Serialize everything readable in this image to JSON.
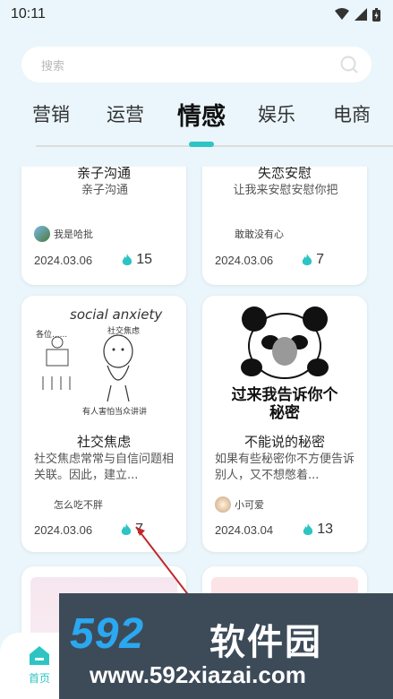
{
  "status_bar": {
    "time": "10:11"
  },
  "search": {
    "placeholder": "搜索"
  },
  "tabs": [
    {
      "label": "营销",
      "active": false
    },
    {
      "label": "运营",
      "active": false
    },
    {
      "label": "情感",
      "active": true
    },
    {
      "label": "娱乐",
      "active": false
    },
    {
      "label": "电商",
      "active": false
    }
  ],
  "cards": [
    {
      "title": "亲子沟通",
      "desc": "亲子沟通",
      "author": "我是哈批",
      "date": "2024.03.06",
      "heat": "15"
    },
    {
      "title": "失恋安慰",
      "desc": "让我来安慰安慰你把",
      "author": "敢敢没有心",
      "date": "2024.03.06",
      "heat": "7"
    },
    {
      "title": "社交焦虑",
      "desc": "社交焦虑常常与自信问题相关联。因此，建立...",
      "author": "怎么吃不胖",
      "date": "2024.03.06",
      "heat": "7",
      "image_text": {
        "heading": "social anxiety",
        "sub": "社交焦虑",
        "left": "各位......",
        "bottom": "有人害怕当众讲讲"
      }
    },
    {
      "title": "不能说的秘密",
      "desc": "如果有些秘密你不方便告诉别人，又不想憋着...",
      "author": "小可爱",
      "date": "2024.03.04",
      "heat": "13",
      "image_text": {
        "caption_line1": "过来我告诉你个",
        "caption_line2": "秘密"
      }
    }
  ],
  "bottom_nav": {
    "home_label": "首页"
  },
  "watermark": {
    "logo": "592",
    "name": "软件园",
    "url": "www.592xiazai.com"
  },
  "colors": {
    "accent": "#2ec4c4",
    "flame": "#2ec4c4",
    "background": "#eaf6fb"
  }
}
